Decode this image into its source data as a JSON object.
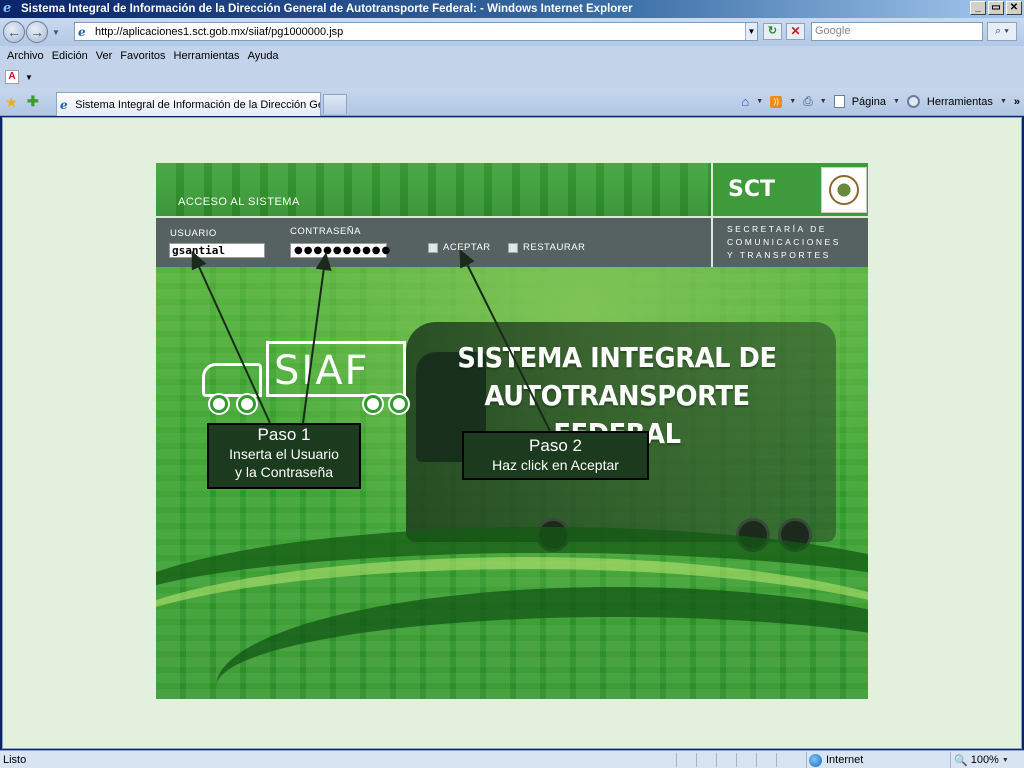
{
  "window": {
    "title": "Sistema Integral de Información de la Dirección General de Autotransporte Federal: - Windows Internet Explorer",
    "buttons": [
      "_",
      "▭",
      "✕"
    ]
  },
  "address_bar": {
    "url": "http://aplicaciones1.sct.gob.mx/siiaf/pg1000000.jsp",
    "search_placeholder": "Google"
  },
  "menu": {
    "items": [
      "Archivo",
      "Edición",
      "Ver",
      "Favoritos",
      "Herramientas",
      "Ayuda"
    ]
  },
  "tabs": {
    "active_label": "Sistema Integral de Información de la Dirección General..."
  },
  "command_bar": {
    "page_label": "Página",
    "tools_label": "Herramientas",
    "more": "»"
  },
  "siaf_page": {
    "access_label": "ACCESO AL SISTEMA",
    "logo_text": "SCT",
    "secretaria_lines": [
      "SECRETARÍA DE",
      "COMUNICACIONES",
      "Y TRANSPORTES"
    ],
    "usuario_label": "USUARIO",
    "usuario_value": "gsantial",
    "password_label": "CONTRASEÑA",
    "password_value": "●●●●●●●●●●",
    "aceptar_label": "ACEPTAR",
    "restaurar_label": "RESTAURAR",
    "logo_word": "SIAF",
    "hero_title_line1": "SISTEMA INTEGRAL DE",
    "hero_title_line2": "AUTOTRANSPORTE FEDERAL"
  },
  "callouts": {
    "step1_title": "Paso 1",
    "step1_line1": "Inserta el Usuario",
    "step1_line2": "y la Contraseña",
    "step2_title": "Paso 2",
    "step2_line1": "Haz click en Aceptar"
  },
  "status_bar": {
    "status_text": "Listo",
    "zone_label": "Internet",
    "zoom_label": "100%"
  },
  "icons": {
    "back": "back-arrow-icon",
    "forward": "forward-arrow-icon",
    "refresh": "refresh-icon",
    "stop": "stop-icon",
    "search": "search-icon",
    "favorites": "star-icon",
    "add_favorite": "add-favorite-icon",
    "home": "home-icon",
    "feeds": "rss-feed-icon",
    "print": "printer-icon"
  },
  "colors": {
    "banner_green": "#2f8e2a",
    "login_band_gray": "#566261",
    "callout_bg": "#1c3a1e",
    "page_bg": "#e3f0de"
  }
}
